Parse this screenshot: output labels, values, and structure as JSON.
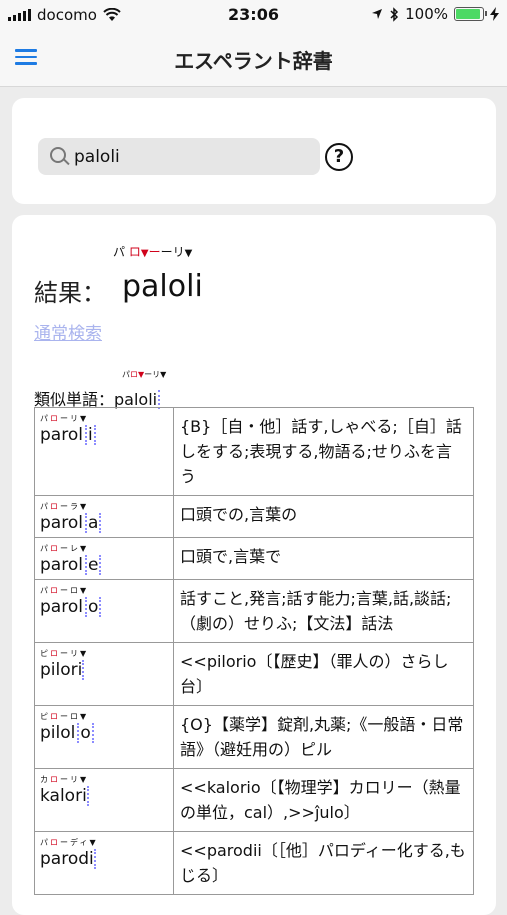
{
  "status_bar": {
    "carrier": "docomo",
    "time": "23:06",
    "battery": "100%",
    "battery_level": 1.0
  },
  "nav": {
    "title": "エスペラント辞書"
  },
  "search": {
    "value": "paloli",
    "help_label": "?"
  },
  "result": {
    "ruby_pre": "パ",
    "ruby_stress": "ロ",
    "ruby_post": "ーリ",
    "label": "結果：",
    "word": "paloli",
    "normal_search_link": "通常検索",
    "similar_label": "類似単語：",
    "similar_ruby_pre": "パ",
    "similar_ruby_stress": "ロ",
    "similar_ruby_post": "ーリ",
    "similar_word": "paloli"
  },
  "entries": [
    {
      "ruby_pre": "パ",
      "ruby_stress": "ロ",
      "ruby_post": "ーリ",
      "stem": "parol",
      "ending": "i",
      "meaning": "{B}［自・他］話す,しゃべる;［自］話しをする;表現する,物語る;せりふを言う"
    },
    {
      "ruby_pre": "パ",
      "ruby_stress": "ロ",
      "ruby_post": "ーラ",
      "stem": "parol",
      "ending": "a",
      "meaning": "口頭での,言葉の"
    },
    {
      "ruby_pre": "パ",
      "ruby_stress": "ロ",
      "ruby_post": "ーレ",
      "stem": "parol",
      "ending": "e",
      "meaning": "口頭で,言葉で"
    },
    {
      "ruby_pre": "パ",
      "ruby_stress": "ロ",
      "ruby_post": "ーロ",
      "stem": "parol",
      "ending": "o",
      "meaning": "話すこと,発言;話す能力;言葉,話,談話;（劇の）せりふ;【文法】話法"
    },
    {
      "ruby_pre": "ピ",
      "ruby_stress": "ロ",
      "ruby_post": "ーリ",
      "stem": "pilori",
      "ending": "",
      "meaning": "<<pilorio〔【歴史】（罪人の）さらし台〕"
    },
    {
      "ruby_pre": "ピ",
      "ruby_stress": "ロ",
      "ruby_post": "ーロ",
      "stem": "pilol",
      "ending": "o",
      "meaning": "{O}【薬学】錠剤,丸薬;《一般語・日常語》（避妊用の）ピル"
    },
    {
      "ruby_pre": "カ",
      "ruby_stress": "ロ",
      "ruby_post": "ーリ",
      "stem": "kalori",
      "ending": "",
      "meaning": "<<kalorio〔【物理学】カロリー（熱量の単位，cal）,>>ĵulo〕"
    },
    {
      "ruby_pre": "パ",
      "ruby_stress": "ロ",
      "ruby_post": "ーディ",
      "stem": "parodi",
      "ending": "",
      "meaning": "<<parodii〔［他］パロディー化する,もじる〕"
    }
  ]
}
